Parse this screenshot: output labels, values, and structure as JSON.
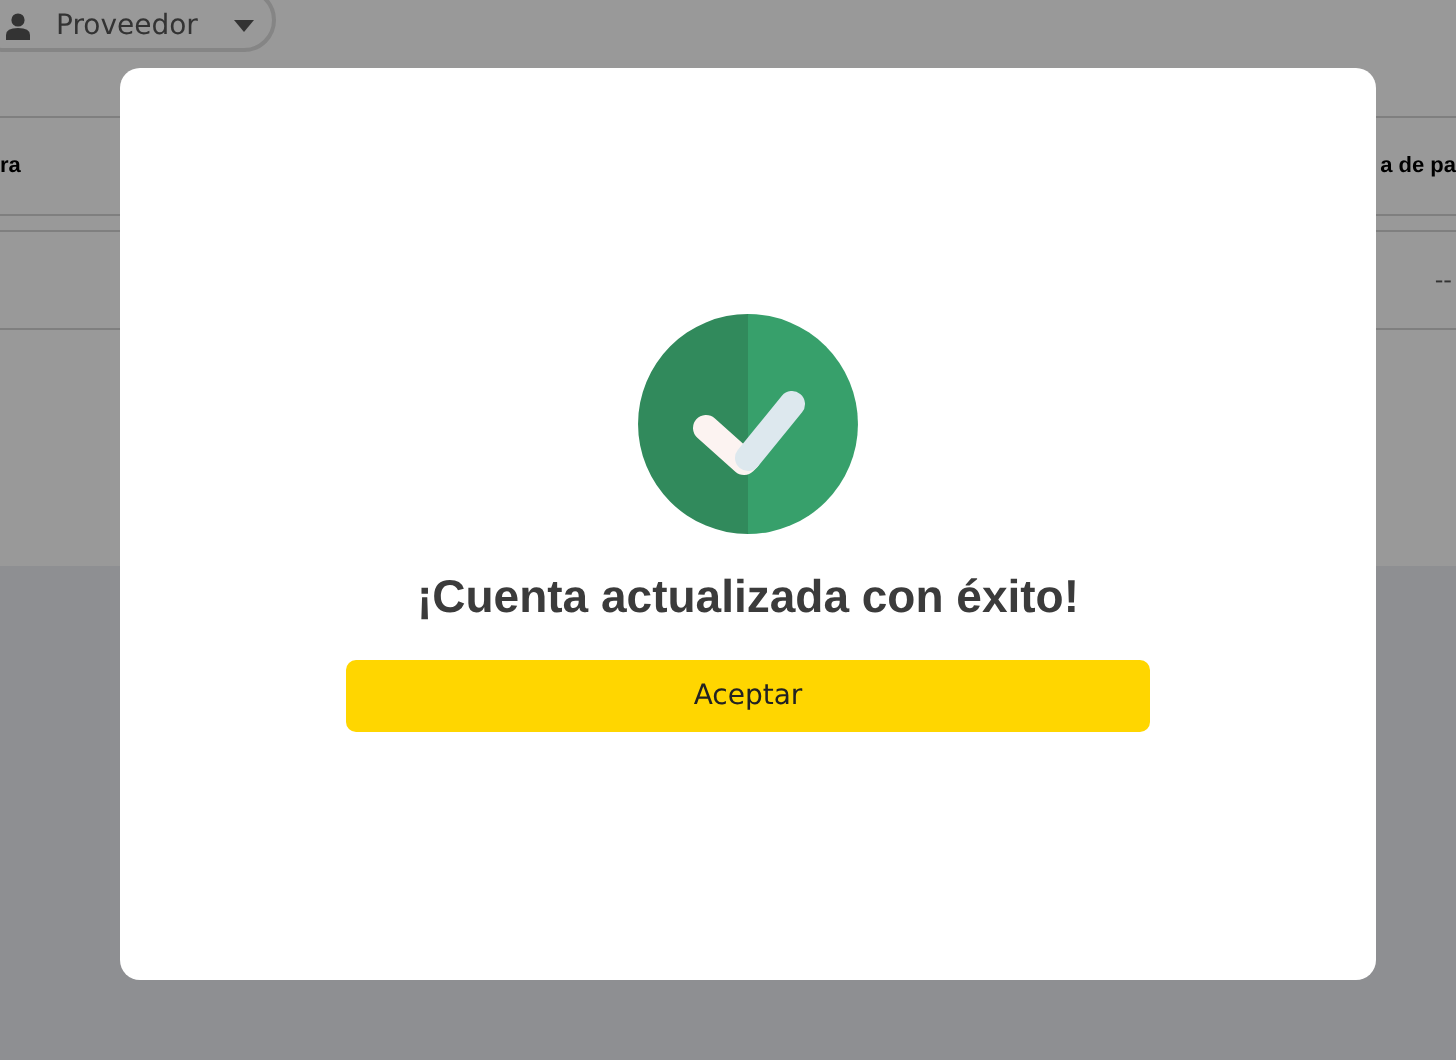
{
  "header": {
    "user_menu": {
      "label": "Proveedor"
    }
  },
  "table": {
    "columns": [
      "ra",
      "a de pa"
    ],
    "rows": [
      {
        "cells": [
          "",
          "--"
        ]
      }
    ]
  },
  "dialog": {
    "title": "¡Cuenta actualizada con éxito!",
    "buttons": [
      "Aceptar"
    ]
  }
}
